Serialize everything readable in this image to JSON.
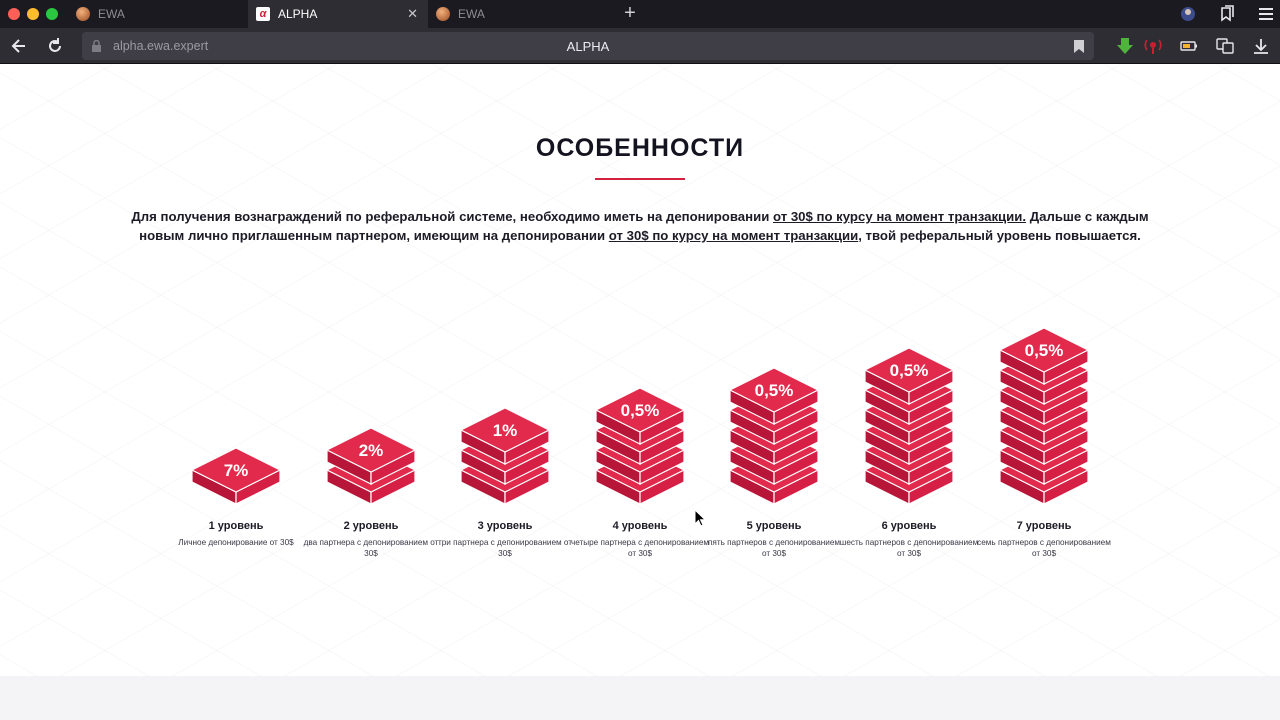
{
  "browser": {
    "tabs": [
      {
        "label": "EWA",
        "active": false
      },
      {
        "label": "ALPHA",
        "active": true
      },
      {
        "label": "EWA",
        "active": false
      }
    ],
    "url": "alpha.ewa.expert",
    "page_title": "ALPHA",
    "accent": "#d3203d"
  },
  "section": {
    "title": "ОСОБЕННОСТИ",
    "desc_part1": "Для получения вознаграждений по реферальной системе, необходимо иметь на депонировании ",
    "desc_link1": "от 30$ по курсу на момент транзакции.",
    "desc_part2": " Дальше с каждым новым лично приглашенным партнером, имеющим на депонировании ",
    "desc_link2": "от 30$ по курсу на момент транзакции",
    "desc_part3": ", твой реферальный уровень повышается."
  },
  "levels": [
    {
      "percent": "7%",
      "name": "1 уровень",
      "desc": "Личное депонирование от 30$",
      "layers": 1
    },
    {
      "percent": "2%",
      "name": "2 уровень",
      "desc": "два партнера с депонированием от 30$",
      "layers": 2
    },
    {
      "percent": "1%",
      "name": "3 уровень",
      "desc": "три партнера с депонированием от 30$",
      "layers": 3
    },
    {
      "percent": "0,5%",
      "name": "4 уровень",
      "desc": "четыре партнера с депонированием от 30$",
      "layers": 4
    },
    {
      "percent": "0,5%",
      "name": "5 уровень",
      "desc": "пять партнеров с депонированием от 30$",
      "layers": 5
    },
    {
      "percent": "0,5%",
      "name": "6 уровень",
      "desc": "шесть партнеров с депонированием от 30$",
      "layers": 6
    },
    {
      "percent": "0,5%",
      "name": "7 уровень",
      "desc": "семь партнеров с депонированием от 30$",
      "layers": 7
    }
  ],
  "icons": [
    "back-icon",
    "reload-icon",
    "lock-icon",
    "bookmark-icon",
    "download-icon",
    "menu-icon",
    "plus-icon",
    "close-icon"
  ]
}
